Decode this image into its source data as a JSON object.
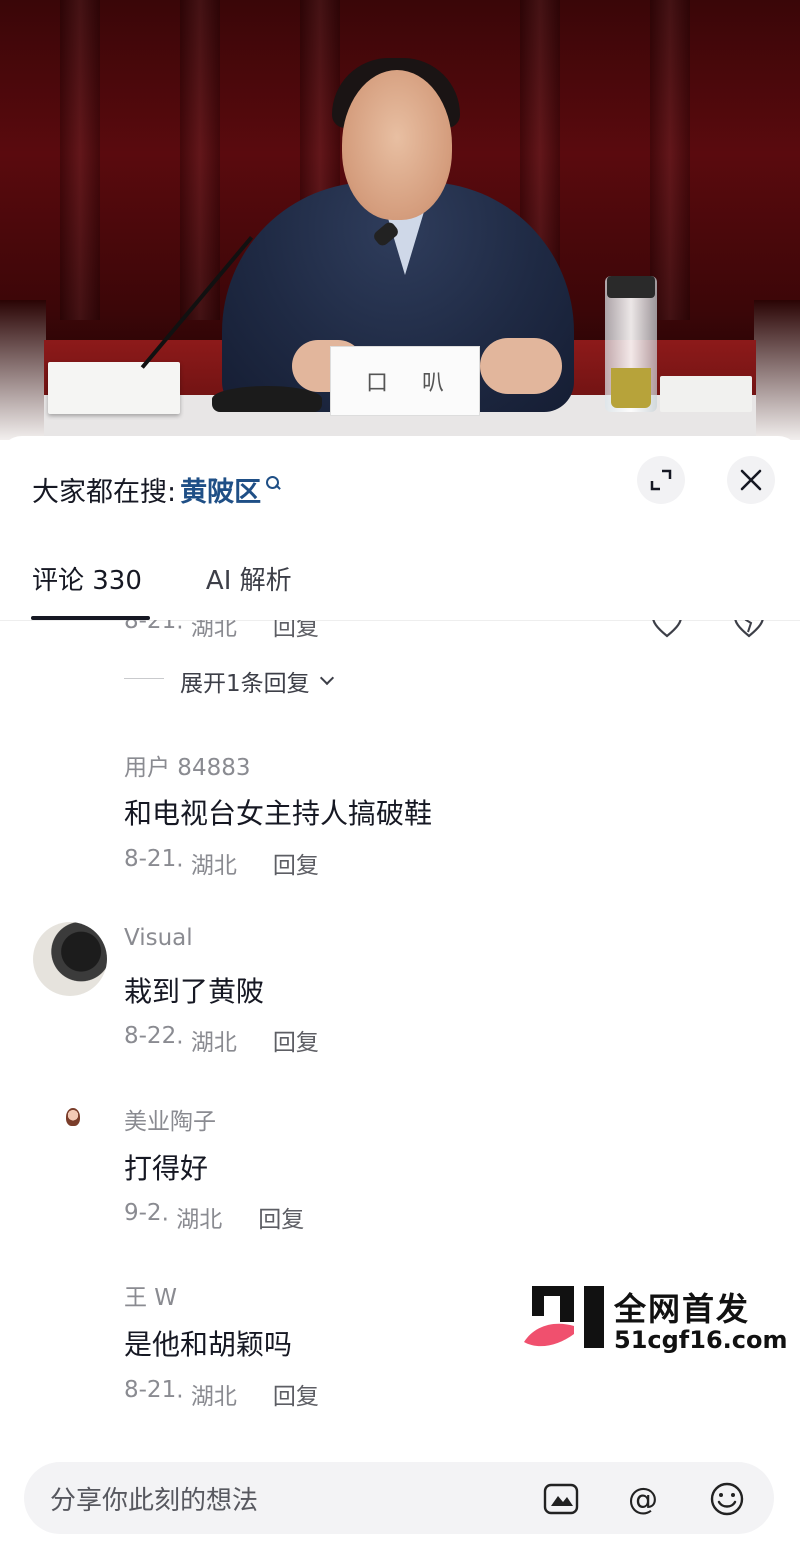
{
  "video": {
    "nameplate_chars": [
      "口",
      "叭"
    ]
  },
  "header": {
    "search_prefix": "大家都在搜:",
    "search_keyword": "黄陂区",
    "expand_icon": "expand-icon",
    "close_icon": "close-icon"
  },
  "tabs": [
    {
      "label": "评论 330",
      "active": true
    },
    {
      "label": "AI 解析",
      "active": false
    }
  ],
  "comments": {
    "partial": {
      "date": "8-21",
      "location": "· 湖北",
      "reply_label": "回复",
      "expand_replies": "展开1条回复"
    },
    "items": [
      {
        "username": "用户 84883",
        "text": "和电视台女主持人搞破鞋",
        "date": "8-21",
        "location": "· 湖北",
        "reply_label": "回复",
        "avatar": "none"
      },
      {
        "username": "Visual",
        "text": "栽到了黄陂",
        "date": "8-22",
        "location": "· 湖北",
        "reply_label": "回复",
        "avatar": "photo"
      },
      {
        "username": "美业陶子",
        "text": "打得好",
        "date": "9-2",
        "location": "· 湖北",
        "reply_label": "回复",
        "avatar": "small-girl"
      },
      {
        "username": "王 W",
        "text": "是他和胡颖吗",
        "date": "8-21",
        "location": "· 湖北",
        "reply_label": "回复",
        "avatar": "none"
      }
    ]
  },
  "watermark": {
    "title": "全网首发",
    "url": "51cgf16.com",
    "accent": "#f0506e"
  },
  "input": {
    "placeholder": "分享你此刻的想法",
    "icons": [
      "image-icon",
      "at-icon",
      "emoji-icon"
    ],
    "at_glyph": "@"
  }
}
